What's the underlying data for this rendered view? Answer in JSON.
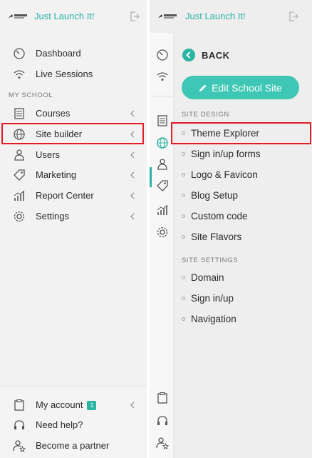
{
  "brand": {
    "name": "Just Launch It!"
  },
  "left_nav": {
    "main": [
      {
        "label": "Dashboard",
        "icon": "gauge-icon"
      },
      {
        "label": "Live Sessions",
        "icon": "wifi-icon"
      }
    ],
    "section_title": "MY SCHOOL",
    "school": [
      {
        "label": "Courses",
        "icon": "book-icon"
      },
      {
        "label": "Site builder",
        "icon": "globe-icon"
      },
      {
        "label": "Users",
        "icon": "user-icon"
      },
      {
        "label": "Marketing",
        "icon": "tag-icon"
      },
      {
        "label": "Report Center",
        "icon": "chart-icon"
      },
      {
        "label": "Settings",
        "icon": "gear-icon"
      }
    ],
    "bottom": [
      {
        "label": "My account",
        "icon": "clipboard-icon",
        "badge": "1"
      },
      {
        "label": "Need help?",
        "icon": "headset-icon"
      },
      {
        "label": "Become a partner",
        "icon": "partner-icon"
      }
    ]
  },
  "submenu": {
    "back_label": "BACK",
    "edit_button": "Edit School Site",
    "site_design_title": "SITE DESIGN",
    "site_design": [
      "Theme Explorer",
      "Sign in/up forms",
      "Logo & Favicon",
      "Blog Setup",
      "Custom code",
      "Site Flavors"
    ],
    "site_settings_title": "SITE SETTINGS",
    "site_settings": [
      "Domain",
      "Sign in/up",
      "Navigation"
    ]
  },
  "colors": {
    "accent": "#2bb3a3",
    "highlight": "#e21b25"
  }
}
